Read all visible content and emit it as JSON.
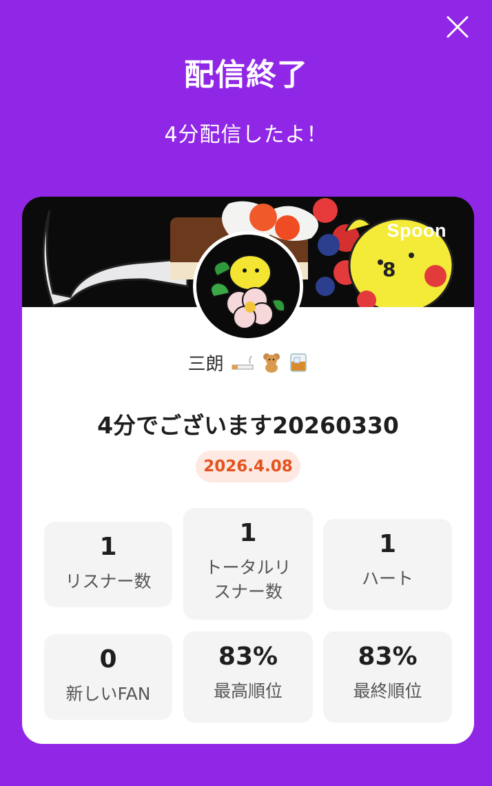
{
  "header": {
    "title": "配信終了",
    "subtitle": "4分配信したよ！",
    "close_icon": "close-icon"
  },
  "card": {
    "brand": "Spoon",
    "username": "三朗",
    "username_emojis": [
      "cigarette-emoji",
      "teddy-bear-emoji",
      "whisky-glass-emoji"
    ],
    "cast_title": "4分でございます20260330",
    "date": "2026.4.08",
    "stats": [
      {
        "value": "1",
        "label": "リスナー数"
      },
      {
        "value": "1",
        "label": "トータルリスナー数"
      },
      {
        "value": "1",
        "label": "ハート"
      },
      {
        "value": "0",
        "label": "新しいFAN"
      },
      {
        "value": "83%",
        "label": "最高順位"
      },
      {
        "value": "83%",
        "label": "最終順位"
      }
    ]
  },
  "colors": {
    "background": "#9127e6",
    "card": "#ffffff",
    "date_badge_bg": "#fde8e2",
    "date_badge_text": "#e4531d",
    "stat_bg": "#f4f4f4"
  }
}
